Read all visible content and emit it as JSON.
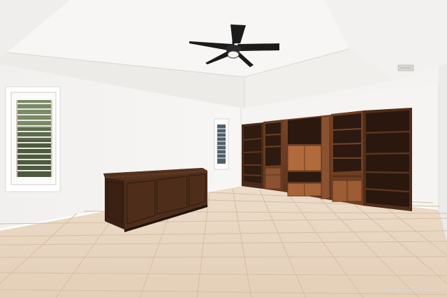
{
  "scene": {
    "watermark_text": "SHOWCASE SELLER",
    "objects": [
      "ceiling-fan-icon",
      "tray-ceiling",
      "air-vent",
      "left-window",
      "middle-window",
      "wooden-desk",
      "built-in-bookcase-wall-unit",
      "tile-floor"
    ],
    "colors": {
      "wall": "#f2f1ef",
      "ceiling": "#f6f5f3",
      "wood": "#6a3c22",
      "wood_dark": "#3f2416",
      "floor_tile": "#ead7c2",
      "grout": "#d8c0a7",
      "fan": "#1e1e1e"
    }
  }
}
